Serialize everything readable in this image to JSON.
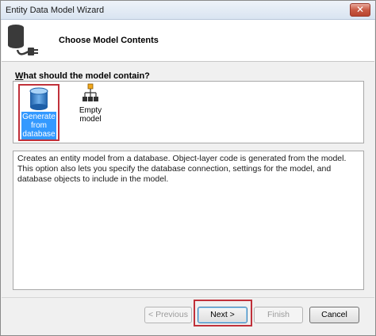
{
  "window": {
    "title": "Entity Data Model Wizard",
    "close_glyph": "✕"
  },
  "header": {
    "title": "Choose Model Contents",
    "icon": "database-plug-icon"
  },
  "prompt": {
    "accel": "W",
    "rest": "hat should the model contain?"
  },
  "choices": [
    {
      "label_lines": [
        "Generate",
        "from",
        "database"
      ],
      "icon": "database-icon",
      "selected": true
    },
    {
      "label": "Empty model",
      "icon": "empty-model-icon",
      "selected": false
    }
  ],
  "description": "Creates an entity model from a database. Object-layer code is generated from the model. This option also lets you specify the database connection, settings for the model, and database objects to include in the model.",
  "buttons": {
    "previous": "< Previous",
    "next": "Next >",
    "finish": "Finish",
    "cancel": "Cancel"
  },
  "colors": {
    "highlight_red": "#c0313a",
    "selection_blue": "#3399ff"
  }
}
